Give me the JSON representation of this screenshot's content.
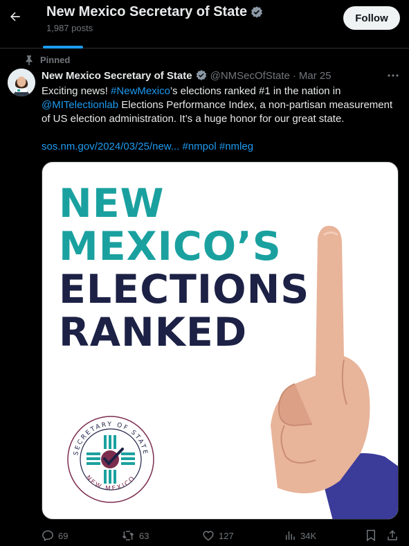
{
  "header": {
    "title": "New Mexico Secretary of State",
    "posts_count": "1,987 posts",
    "follow_label": "Follow"
  },
  "post": {
    "pinned_label": "Pinned",
    "author": "New Mexico Secretary of State",
    "handle": "@NMSecOfState",
    "separator": "·",
    "date": "Mar 25",
    "text": {
      "t1": "Exciting news! ",
      "hashtag1": "#NewMexico",
      "t2": "’s elections ranked #1 in the nation in ",
      "mention": "@MITelectionlab",
      "t3": " Elections Performance Index, a non-partisan measurement of US election administration. It’s a huge honor for our great state."
    },
    "link": "sos.nm.gov/2024/03/25/new...",
    "hashtag2": "#nmpol",
    "hashtag3": "#nmleg"
  },
  "media": {
    "line1": "NEW",
    "line2": "MEXICO’S",
    "line3": "ELECTIONS",
    "line4": "RANKED",
    "seal_top": "SECRETARY OF STATE",
    "seal_bottom": "NEW MEXICO",
    "colors": {
      "teal": "#1aa19f",
      "navy": "#1c2145",
      "maroon": "#7b2d4e",
      "sleeve": "#3b3b9a"
    }
  },
  "actions": {
    "replies": "69",
    "reposts": "63",
    "likes": "127",
    "views": "34K"
  },
  "icons": [
    "back-arrow-icon",
    "verified-badge-icon",
    "pin-icon",
    "more-icon",
    "reply-icon",
    "repost-icon",
    "like-icon",
    "views-icon",
    "bookmark-icon",
    "share-icon"
  ],
  "colors": {
    "background": "#000000",
    "accent": "#1d9bf0",
    "text": "#e7e9ea",
    "muted": "#71767b",
    "border": "#2f3336",
    "verified": "#8b98a5"
  }
}
